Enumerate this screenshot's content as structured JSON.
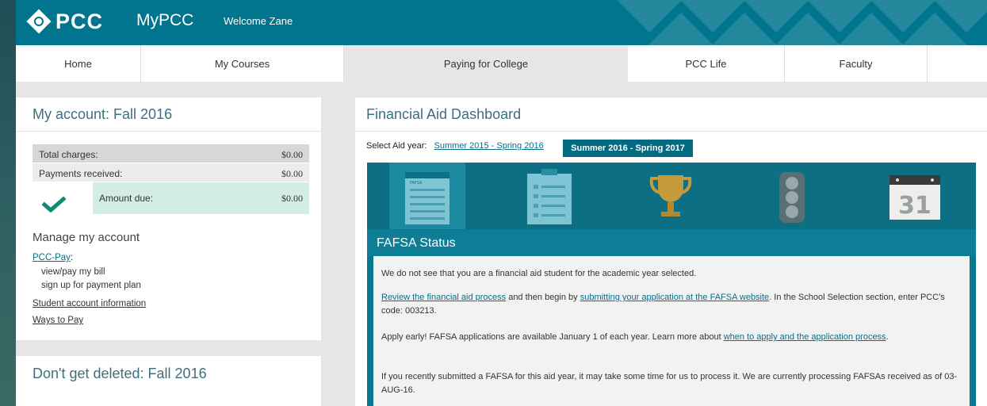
{
  "header": {
    "logo": "PCC",
    "app_name": "MyPCC",
    "welcome": "Welcome Zane",
    "brand_color": "#00758d"
  },
  "nav": {
    "items": [
      {
        "label": "Home",
        "active": false
      },
      {
        "label": "My Courses",
        "active": false
      },
      {
        "label": "Paying for College",
        "active": true
      },
      {
        "label": "PCC Life",
        "active": false
      },
      {
        "label": "Faculty",
        "active": false
      }
    ]
  },
  "account": {
    "title": "My account: Fall 2016",
    "rows": [
      {
        "label": "Total charges:",
        "value": "$0.00"
      },
      {
        "label": "Payments received:",
        "value": "$0.00"
      },
      {
        "label": "Amount due:",
        "value": "$0.00"
      }
    ],
    "check_icon": "checkmark-icon",
    "manage_title": "Manage my account",
    "pcc_pay_link": "PCC-Pay",
    "pcc_pay_colon": ":",
    "pcc_pay_subitems": [
      "view/pay my bill",
      "sign up for payment plan"
    ],
    "links": [
      "Student account information",
      "Ways to Pay"
    ]
  },
  "deleted": {
    "title": "Don't get deleted: Fall 2016"
  },
  "financial_aid": {
    "title": "Financial Aid Dashboard",
    "select_label": "Select Aid year:",
    "years": [
      "Summer 2015 - Spring 2016",
      "Summer 2016 - Spring 2017"
    ],
    "selected_year_index": 1,
    "icons": [
      {
        "name": "fafsa-form-icon",
        "label": "FAFSA"
      },
      {
        "name": "checklist-icon"
      },
      {
        "name": "trophy-icon"
      },
      {
        "name": "traffic-light-icon"
      },
      {
        "name": "calendar-icon",
        "label": "31"
      }
    ],
    "status_title": "FAFSA Status",
    "p1": "We do not see that you are a financial aid student for the academic year selected.",
    "p2_link1": "Review the financial aid process",
    "p2_mid": " and then begin by ",
    "p2_link2": "submitting your application at the FAFSA website",
    "p2_end": ". In the School Selection section, enter PCC's code: 003213.",
    "p3_text": "Apply early! FAFSA applications are available January 1 of each year. Learn more about ",
    "p3_link": "when to apply and the application process",
    "p3_end": ".",
    "p4": "If you recently submitted a FAFSA for this aid year, it may take some time for us to process it. We are currently processing FAFSAs received as of 03-AUG-16."
  }
}
